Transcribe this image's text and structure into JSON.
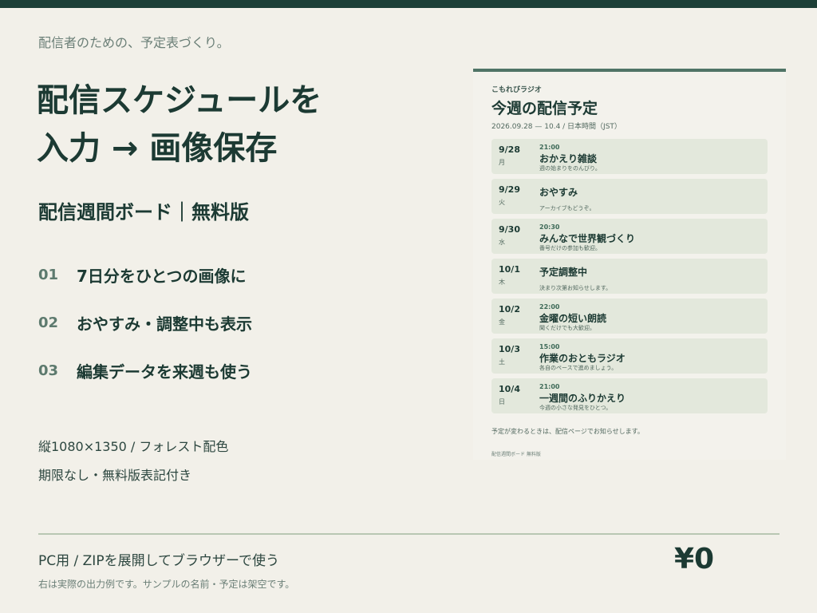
{
  "hero": {
    "tagline": "配信者のための、予定表づくり。",
    "headline_line1": "配信スケジュールを",
    "headline_line2": "入力 → 画像保存",
    "subtitle": "配信週間ボード｜無料版"
  },
  "features": [
    {
      "num": "01",
      "text": "7日分をひとつの画像に"
    },
    {
      "num": "02",
      "text": "おやすみ・調整中も表示"
    },
    {
      "num": "03",
      "text": "編集データを来週も使う"
    }
  ],
  "specs": {
    "size_line": "縦1080×1350 / フォレスト配色",
    "license_line": "期限なし・無料版表記付き"
  },
  "footer": {
    "usage": "PC用 / ZIPを展開してブラウザーで使う",
    "note": "右は実際の出力例です。サンプルの名前・予定は架空です。",
    "price": "¥0"
  },
  "board": {
    "station": "こもれびラジオ",
    "title": "今週の配信予定",
    "range": "2026.09.28 — 10.4  /  日本時間（JST）",
    "rows": [
      {
        "date": "9/28",
        "day": "月",
        "time": "21:00",
        "title": "おかえり雑談",
        "desc": "週の始まりをのんびり。"
      },
      {
        "date": "9/29",
        "day": "火",
        "time": "",
        "title": "おやすみ",
        "desc": "アーカイブもどうぞ。"
      },
      {
        "date": "9/30",
        "day": "水",
        "time": "20:30",
        "title": "みんなで世界観づくり",
        "desc": "番号だけの参加も歓迎。"
      },
      {
        "date": "10/1",
        "day": "木",
        "time": "",
        "title": "予定調整中",
        "desc": "決まり次第お知らせします。"
      },
      {
        "date": "10/2",
        "day": "金",
        "time": "22:00",
        "title": "金曜の短い朗読",
        "desc": "聞くだけでも大歓迎。"
      },
      {
        "date": "10/3",
        "day": "土",
        "time": "15:00",
        "title": "作業のおともラジオ",
        "desc": "各自のペースで進めましょう。"
      },
      {
        "date": "10/4",
        "day": "日",
        "time": "21:00",
        "title": "一週間のふりかえり",
        "desc": "今週の小さな発見をひとつ。"
      }
    ],
    "note": "予定が変わるときは、配信ページでお知らせします。",
    "credit": "配信週間ボード 無料版"
  },
  "colors": {
    "background": "#f2f0e9",
    "accent": "#1d3f37",
    "row_background": "#e3e8dc"
  }
}
